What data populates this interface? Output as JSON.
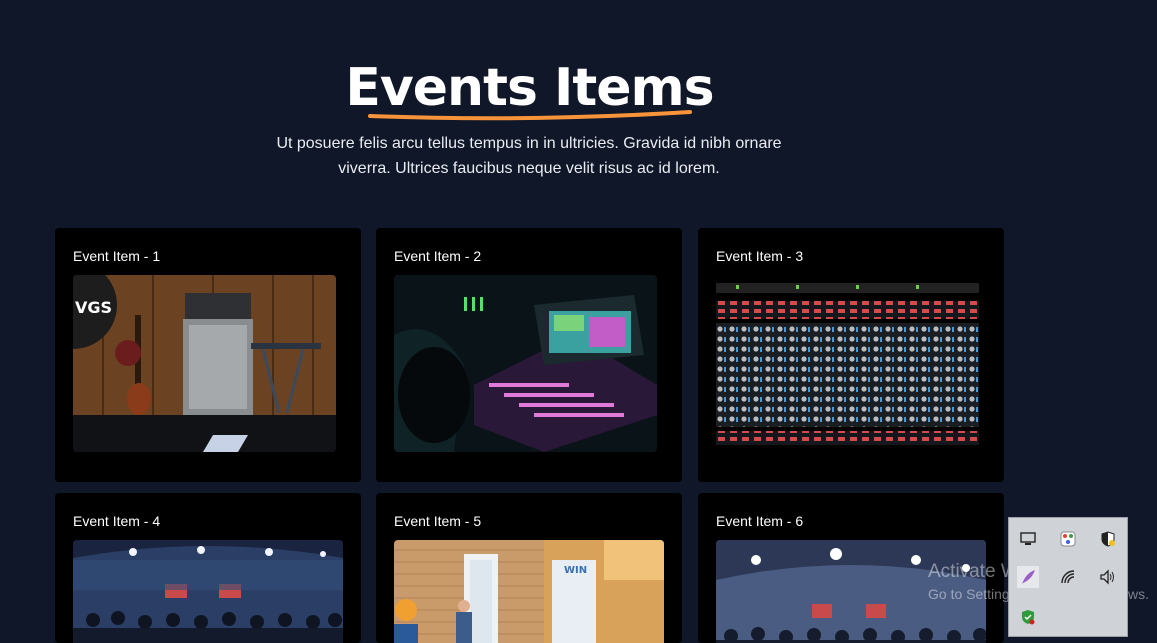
{
  "header": {
    "title": "Events Items",
    "subtitle": "Ut posuere felis arcu tellus tempus in in ultricies. Gravida id nibh ornare viverra. Ultrices faucibus neque velit risus ac id lorem.",
    "accent_color": "#f7943a"
  },
  "events": [
    {
      "title": "Event Item - 1",
      "image": "guitar-amp-stage-photo"
    },
    {
      "title": "Event Item - 2",
      "image": "audio-mixer-console-photo"
    },
    {
      "title": "Event Item - 3",
      "image": "soundboard-faders-photo"
    },
    {
      "title": "Event Item - 4",
      "image": "conference-audience-photo"
    },
    {
      "title": "Event Item - 5",
      "image": "speaker-presentation-photo"
    },
    {
      "title": "Event Item - 6",
      "image": "conference-hall-photo"
    }
  ],
  "system_tray": {
    "icons": [
      "display-icon",
      "color-picker-icon",
      "security-shield-icon",
      "feather-icon",
      "wifi-icon",
      "volume-icon",
      "defender-icon"
    ]
  },
  "watermark": {
    "line1": "Activate Windows",
    "line2": "Go to Settings to activate Windows."
  },
  "colors": {
    "background": "#101728",
    "card": "#000000"
  }
}
